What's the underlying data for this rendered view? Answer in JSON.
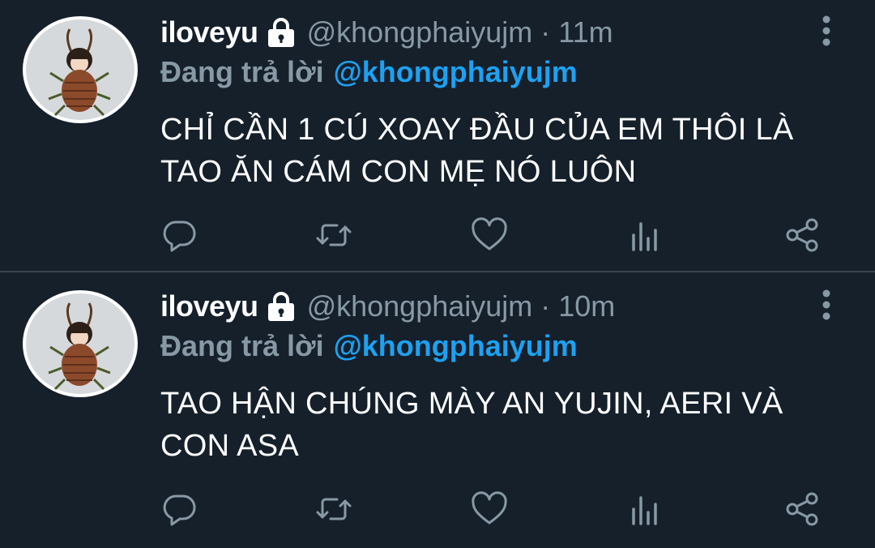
{
  "tweets": [
    {
      "display_name": "iloveyu",
      "handle": "@khongphaiyujm",
      "separator": "·",
      "time": "11m",
      "reply_prefix": "Đang trả lời",
      "reply_to": "@khongphaiyujm",
      "text": "CHỈ CẦN 1 CÚ XOAY ĐẦU CỦA EM THÔI LÀ TAO ĂN CÁM CON MẸ NÓ LUÔN"
    },
    {
      "display_name": "iloveyu",
      "handle": "@khongphaiyujm",
      "separator": "·",
      "time": "10m",
      "reply_prefix": "Đang trả lời",
      "reply_to": "@khongphaiyujm",
      "text": "TAO HẬN CHÚNG MÀY AN YUJIN, AERI VÀ CON ASA"
    }
  ],
  "icons": {
    "lock": "lock-icon",
    "more": "more-vertical-icon",
    "reply": "reply-icon",
    "retweet": "retweet-icon",
    "like": "heart-icon",
    "analytics": "analytics-icon",
    "share": "share-icon"
  },
  "colors": {
    "background": "#15202b",
    "text": "#ffffff",
    "muted": "#8899a6",
    "link": "#1da1f2",
    "divider": "#38444d"
  }
}
